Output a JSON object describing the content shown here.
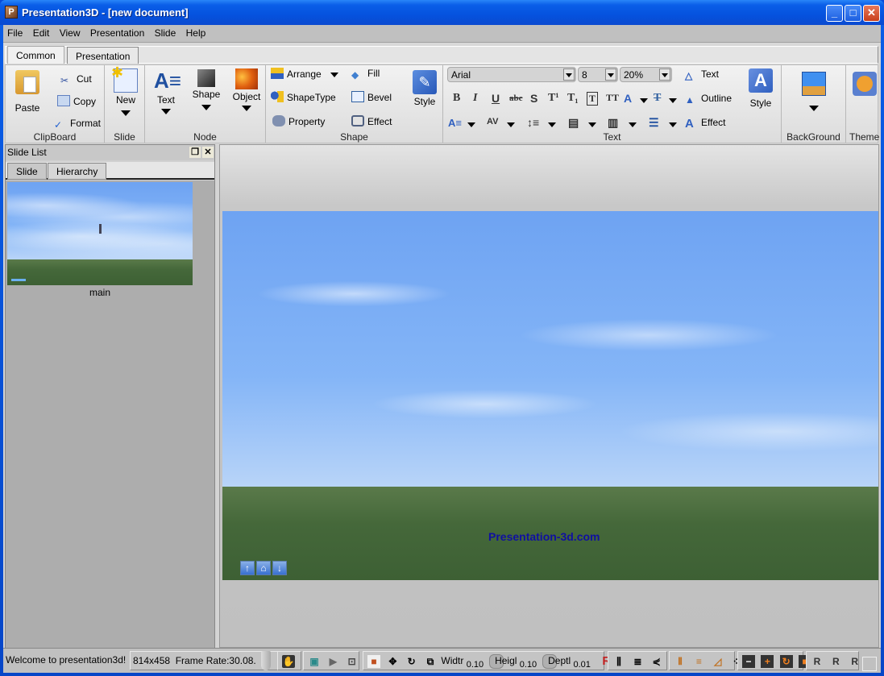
{
  "window": {
    "title": "Presentation3D - [new document]",
    "icon_letter": "P",
    "minimize": "_",
    "maximize": "□",
    "close": "✕"
  },
  "menu": [
    "File",
    "Edit",
    "View",
    "Presentation",
    "Slide",
    "Help"
  ],
  "ribbon_tabs": [
    {
      "label": "Common",
      "active": true
    },
    {
      "label": "Presentation",
      "active": false
    }
  ],
  "ribbon": {
    "clipboard": {
      "label": "ClipBoard",
      "paste": "Paste",
      "cut": "Cut",
      "copy": "Copy",
      "format": "Format"
    },
    "slide": {
      "label": "Slide",
      "new": "New"
    },
    "node": {
      "label": "Node",
      "text": "Text",
      "shape": "Shape",
      "object": "Object"
    },
    "shape": {
      "label": "Shape",
      "arrange": "Arrange",
      "shapetype": "ShapeType",
      "property": "Property",
      "fill": "Fill",
      "bevel": "Bevel",
      "effect": "Effect",
      "style": "Style"
    },
    "text": {
      "label": "Text",
      "font": "Arial",
      "size": "8",
      "zoom": "20%",
      "text_btn": "Text",
      "outline_btn": "Outline",
      "effect_btn": "Effect",
      "style": "Style",
      "format_buttons": [
        "B",
        "I",
        "U",
        "abc",
        "S",
        "T¹",
        "T₁",
        "T",
        "TT",
        "A",
        "T"
      ]
    },
    "background": {
      "label": "BackGround"
    },
    "theme": {
      "label": "Theme"
    }
  },
  "slide_panel": {
    "title": "Slide List",
    "tabs": [
      {
        "label": "Slide",
        "active": true
      },
      {
        "label": "Hierarchy",
        "active": false
      }
    ],
    "slides": [
      {
        "name": "main"
      }
    ]
  },
  "canvas": {
    "website_text": "Presentation-3d.com",
    "nav": [
      "↑",
      "⌂",
      "↓"
    ]
  },
  "status": {
    "message": "Welcome to presentation3d!",
    "resolution": "814x458",
    "frame_rate": "Frame Rate:30.08.",
    "width_label": "Widtr",
    "width_value": "0.10",
    "height_label": "Heigl",
    "height_value": "0.10",
    "depth_label": "Deptl",
    "depth_value": "0.01"
  }
}
